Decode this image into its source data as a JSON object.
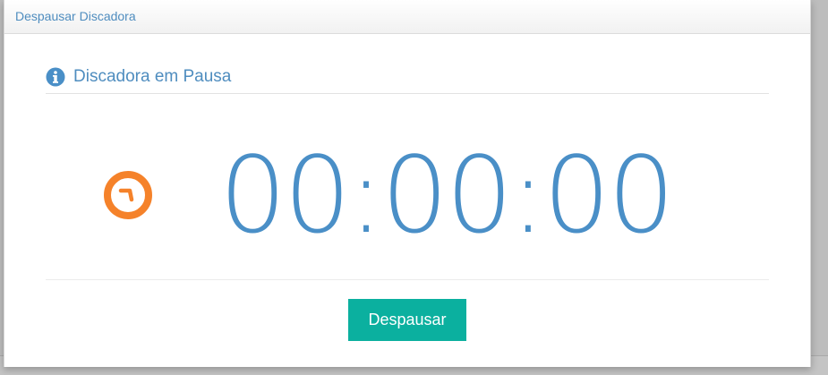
{
  "modal": {
    "title": "Despausar Discadora"
  },
  "section": {
    "title": "Discadora em Pausa",
    "icon": "info-icon"
  },
  "timer": {
    "icon": "clock-icon",
    "value": "00:00:00"
  },
  "actions": {
    "unpause_label": "Despausar"
  },
  "colors": {
    "accent_blue": "#4a8fc7",
    "clock_orange": "#f5822a",
    "button_teal": "#0bb09f"
  }
}
